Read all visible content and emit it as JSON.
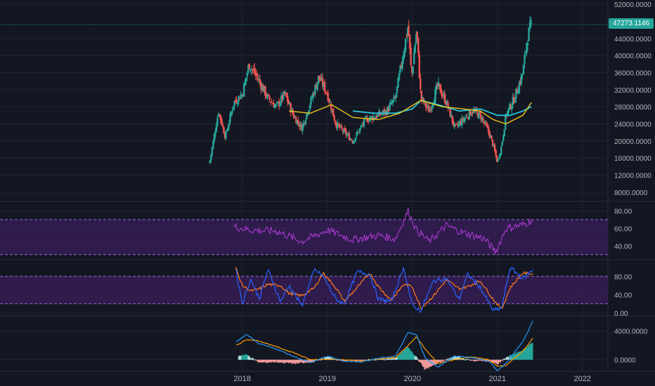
{
  "colors": {
    "background": "#131722",
    "grid": "#1f2430",
    "axis_text": "#b2b5be",
    "up": "#26a69a",
    "down": "#ef5350",
    "sma_fast": "#f0c419",
    "sma_slow": "#26c6da",
    "rsi_line": "#b23ad8",
    "band": "#3a1f5c",
    "band_line": "#9c6ad9",
    "stoch_k": "#2962ff",
    "stoch_d": "#ff7a1a",
    "macd": "#2196f3",
    "signal": "#ff9800",
    "last_price_line": "#26a69a"
  },
  "last_price_label": "47273.1146",
  "chart_data": [
    {
      "type": "candlestick",
      "pane": "price",
      "ylim": [
        6000,
        53000
      ],
      "y_ticks": [
        "8000.0000",
        "12000.0000",
        "16000.0000",
        "20000.0000",
        "24000.0000",
        "28000.0000",
        "32000.0000",
        "36000.0000",
        "40000.0000",
        "44000.0000",
        "52000.0000"
      ],
      "y_tick_values": [
        8000,
        12000,
        16000,
        20000,
        24000,
        28000,
        32000,
        36000,
        40000,
        44000,
        52000
      ],
      "x_ticks": [
        "2018",
        "2019",
        "2020",
        "2021",
        "2022"
      ],
      "x_tick_values": [
        2018.0,
        2019.0,
        2020.0,
        2021.0,
        2022.0
      ],
      "xlim": [
        2015.15,
        2022.3
      ],
      "last_price": 47273.1146,
      "ohlc_anchor_x": [
        2017.62,
        2017.72,
        2017.8,
        2017.9,
        2018.0,
        2018.08,
        2018.2,
        2018.3,
        2018.4,
        2018.5,
        2018.6,
        2018.7,
        2018.8,
        2018.9,
        2019.0,
        2019.1,
        2019.2,
        2019.3,
        2019.45,
        2019.6,
        2019.7,
        2019.8,
        2019.95,
        2019.99,
        2020.05,
        2020.1,
        2020.2,
        2020.3,
        2020.4,
        2020.5,
        2020.6,
        2020.7,
        2020.8,
        2020.9,
        2020.95,
        2021.0,
        2021.05,
        2021.1,
        2021.2,
        2021.3,
        2021.35,
        2021.4
      ],
      "ohlc_anchor_close": [
        15500,
        27000,
        21000,
        29000,
        31000,
        38000,
        34000,
        30000,
        28000,
        31000,
        26000,
        23000,
        29000,
        35000,
        31000,
        24000,
        22000,
        20000,
        25000,
        26000,
        27000,
        30000,
        47000,
        35000,
        46000,
        30000,
        27000,
        33000,
        29000,
        23000,
        25000,
        27000,
        26000,
        22000,
        19000,
        15000,
        19000,
        26000,
        30000,
        36000,
        44000,
        47273
      ],
      "sma_fast_anchor": [
        [
          2018.55,
          27000
        ],
        [
          2018.8,
          26500
        ],
        [
          2019.05,
          28500
        ],
        [
          2019.3,
          25500
        ],
        [
          2019.6,
          25000
        ],
        [
          2019.85,
          26500
        ],
        [
          2020.1,
          29500
        ],
        [
          2020.35,
          28000
        ],
        [
          2020.6,
          27500
        ],
        [
          2020.8,
          27000
        ],
        [
          2020.95,
          25000
        ],
        [
          2021.1,
          24000
        ],
        [
          2021.3,
          26000
        ],
        [
          2021.4,
          29000
        ]
      ],
      "sma_slow_anchor": [
        [
          2019.3,
          27000
        ],
        [
          2019.55,
          26500
        ],
        [
          2019.8,
          26500
        ],
        [
          2020.0,
          27500
        ],
        [
          2020.1,
          29500
        ],
        [
          2020.3,
          28500
        ],
        [
          2020.55,
          27000
        ],
        [
          2020.8,
          27500
        ],
        [
          2021.0,
          26000
        ],
        [
          2021.15,
          26000
        ],
        [
          2021.3,
          27000
        ],
        [
          2021.4,
          28000
        ]
      ]
    },
    {
      "type": "line",
      "pane": "rsi",
      "ylim": [
        25,
        90
      ],
      "y_ticks": [
        "40.00",
        "60.00",
        "80.00"
      ],
      "y_tick_values": [
        40,
        60,
        80
      ],
      "band": [
        30,
        70
      ],
      "anchor_x": [
        2017.9,
        2018.1,
        2018.4,
        2018.7,
        2019.0,
        2019.3,
        2019.6,
        2019.8,
        2019.95,
        2020.05,
        2020.2,
        2020.4,
        2020.6,
        2020.85,
        2020.98,
        2021.1,
        2021.3,
        2021.42
      ],
      "anchor_y": [
        62,
        58,
        57,
        45,
        58,
        47,
        52,
        48,
        80,
        58,
        45,
        63,
        55,
        48,
        33,
        60,
        64,
        70
      ]
    },
    {
      "type": "line",
      "pane": "stochastic",
      "ylim": [
        -5,
        115
      ],
      "y_ticks": [
        "0.00",
        "40.00",
        "80.00"
      ],
      "y_tick_values": [
        0,
        40,
        80
      ],
      "band": [
        20,
        80
      ],
      "k_anchor_x": [
        2017.92,
        2018.0,
        2018.1,
        2018.2,
        2018.3,
        2018.45,
        2018.55,
        2018.7,
        2018.85,
        2018.95,
        2019.1,
        2019.2,
        2019.35,
        2019.5,
        2019.6,
        2019.75,
        2019.9,
        2020.0,
        2020.1,
        2020.25,
        2020.4,
        2020.55,
        2020.65,
        2020.8,
        2020.95,
        2021.05,
        2021.15,
        2021.3,
        2021.42
      ],
      "k_anchor_y": [
        100,
        20,
        75,
        30,
        95,
        25,
        60,
        15,
        95,
        80,
        30,
        20,
        90,
        85,
        30,
        25,
        100,
        15,
        5,
        70,
        75,
        30,
        85,
        55,
        5,
        10,
        100,
        75,
        95
      ]
    },
    {
      "type": "bar+line",
      "pane": "macd",
      "ylim": [
        -1500,
        6000
      ],
      "y_ticks": [
        "0.0000",
        "4000.0000"
      ],
      "y_tick_values": [
        0,
        4000
      ],
      "macd_anchor_x": [
        2017.93,
        2018.05,
        2018.2,
        2018.4,
        2018.6,
        2018.8,
        2019.0,
        2019.2,
        2019.4,
        2019.6,
        2019.8,
        2019.95,
        2020.05,
        2020.15,
        2020.3,
        2020.5,
        2020.7,
        2020.9,
        2021.0,
        2021.1,
        2021.2,
        2021.3,
        2021.42
      ],
      "macd_anchor_y": [
        2500,
        3500,
        2200,
        1500,
        500,
        -400,
        500,
        -200,
        -300,
        200,
        500,
        3800,
        3500,
        200,
        -1000,
        500,
        300,
        -200,
        -1500,
        -500,
        1000,
        2500,
        5400
      ],
      "signal_anchor_y": [
        2000,
        2800,
        2600,
        1800,
        1000,
        0,
        100,
        0,
        -200,
        100,
        300,
        2000,
        3200,
        1500,
        -500,
        0,
        400,
        0,
        -900,
        -800,
        200,
        1200,
        3000
      ]
    }
  ]
}
